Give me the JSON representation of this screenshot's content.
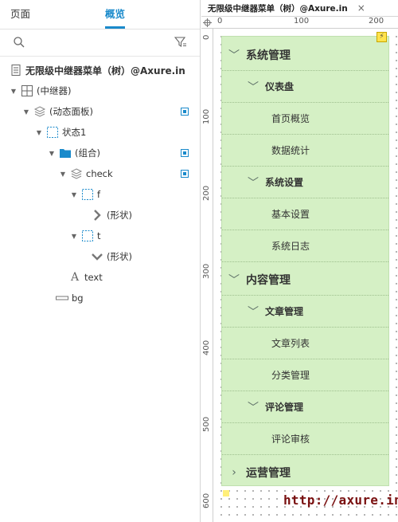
{
  "left_panel": {
    "tabs": [
      {
        "label": "页面",
        "active": false
      },
      {
        "label": "概览",
        "active": true
      }
    ],
    "outline": [
      {
        "label": "无限级中继器菜单（树）@Axure.in",
        "icon": "page-icon",
        "bold": true
      },
      {
        "label": "(中继器)",
        "icon": "repeater-icon"
      },
      {
        "label": "(动态面板)",
        "icon": "dynamic-panel-icon",
        "visible_toggle": true
      },
      {
        "label": "状态1",
        "icon": "state-icon"
      },
      {
        "label": "(组合)",
        "icon": "folder-icon",
        "visible_toggle": true
      },
      {
        "label": "check",
        "icon": "dynamic-panel-icon",
        "visible_toggle": true
      },
      {
        "label": "f",
        "icon": "state-icon"
      },
      {
        "label": "(形状)",
        "icon": "chevron-right-shape-icon"
      },
      {
        "label": "t",
        "icon": "state-icon"
      },
      {
        "label": "(形状)",
        "icon": "chevron-down-shape-icon"
      },
      {
        "label": "text",
        "icon": "text-icon"
      },
      {
        "label": "bg",
        "icon": "rectangle-icon"
      }
    ]
  },
  "right_panel": {
    "doc_tab_title": "无限级中继器菜单（树）@Axure.in",
    "close_glyph": "×",
    "hruler": [
      "0",
      "100",
      "200"
    ],
    "vruler": [
      "0",
      "100",
      "200",
      "300",
      "400",
      "500",
      "600"
    ],
    "menu_items": [
      {
        "label": "系统管理",
        "level": 1,
        "chevron": "down"
      },
      {
        "label": "仪表盘",
        "level": 2,
        "chevron": "down"
      },
      {
        "label": "首页概览",
        "level": 3
      },
      {
        "label": "数据统计",
        "level": 3
      },
      {
        "label": "系统设置",
        "level": 2,
        "chevron": "down"
      },
      {
        "label": "基本设置",
        "level": 3
      },
      {
        "label": "系统日志",
        "level": 3
      },
      {
        "label": "内容管理",
        "level": 1,
        "chevron": "down"
      },
      {
        "label": "文章管理",
        "level": 2,
        "chevron": "down"
      },
      {
        "label": "文章列表",
        "level": 3
      },
      {
        "label": "分类管理",
        "level": 3
      },
      {
        "label": "评论管理",
        "level": 2,
        "chevron": "down"
      },
      {
        "label": "评论审核",
        "level": 3
      },
      {
        "label": "运营管理",
        "level": 1,
        "chevron": "right"
      }
    ],
    "watermark": "http://axure.in"
  },
  "colors": {
    "accent": "#1a8acb",
    "menu_bg": "#d5f0c5",
    "watermark": "#7a1111"
  }
}
